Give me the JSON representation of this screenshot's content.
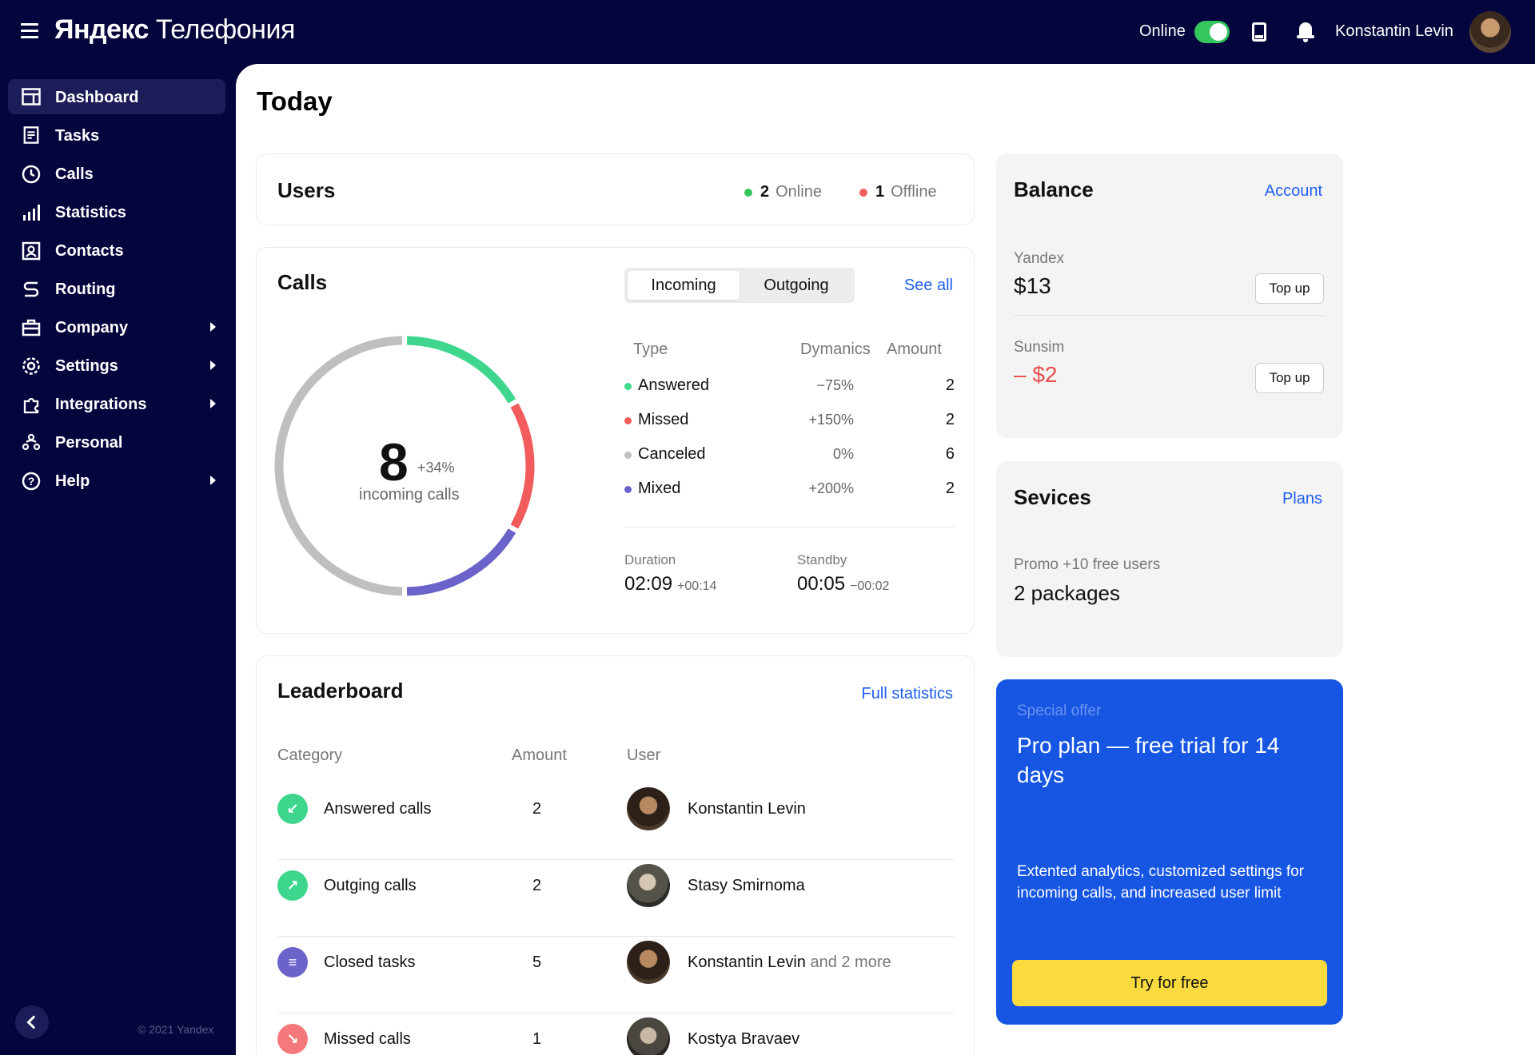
{
  "header": {
    "logo_bold": "Яндекс",
    "logo_rest": "Телефония",
    "online_label": "Online",
    "online_toggle": true,
    "user_name": "Konstantin Levin"
  },
  "sidebar": {
    "items": [
      {
        "label": "Dashboard",
        "icon": "dashboard-icon",
        "active": true,
        "has_submenu": false
      },
      {
        "label": "Tasks",
        "icon": "tasks-icon",
        "active": false,
        "has_submenu": false
      },
      {
        "label": "Calls",
        "icon": "clock-icon",
        "active": false,
        "has_submenu": false
      },
      {
        "label": "Statistics",
        "icon": "bar-chart-icon",
        "active": false,
        "has_submenu": false
      },
      {
        "label": "Contacts",
        "icon": "contacts-icon",
        "active": false,
        "has_submenu": false
      },
      {
        "label": "Routing",
        "icon": "routing-icon",
        "active": false,
        "has_submenu": false
      },
      {
        "label": "Company",
        "icon": "briefcase-icon",
        "active": false,
        "has_submenu": true
      },
      {
        "label": "Settings",
        "icon": "gear-icon",
        "active": false,
        "has_submenu": true
      },
      {
        "label": "Integrations",
        "icon": "puzzle-icon",
        "active": false,
        "has_submenu": true
      },
      {
        "label": "Personal",
        "icon": "people-icon",
        "active": false,
        "has_submenu": false
      },
      {
        "label": "Help",
        "icon": "help-icon",
        "active": false,
        "has_submenu": true
      }
    ],
    "copyright": "© 2021 Yandex"
  },
  "page": {
    "title": "Today"
  },
  "users": {
    "title": "Users",
    "online_count": "2",
    "online_label": "Online",
    "offline_count": "1",
    "offline_label": "Offline"
  },
  "calls": {
    "title": "Calls",
    "tabs": [
      "Incoming",
      "Outgoing"
    ],
    "active_tab": "Incoming",
    "see_all": "See all",
    "total": "8",
    "total_delta": "+34%",
    "total_label": "incoming calls",
    "columns": [
      "Type",
      "Dymanics",
      "Amount"
    ],
    "rows": [
      {
        "type": "Answered",
        "dynamics": "−75%",
        "amount": "2",
        "color": "#3dd68c"
      },
      {
        "type": "Missed",
        "dynamics": "+150%",
        "amount": "2",
        "color": "#f25c5c"
      },
      {
        "type": "Canceled",
        "dynamics": "0%",
        "amount": "6",
        "color": "#bfbfbf"
      },
      {
        "type": "Mixed",
        "dynamics": "+200%",
        "amount": "2",
        "color": "#6b63c9"
      }
    ],
    "duration_label": "Duration",
    "duration_value": "02:09",
    "duration_delta": "+00:14",
    "standby_label": "Standby",
    "standby_value": "00:05",
    "standby_delta": "−00:02"
  },
  "leaderboard": {
    "title": "Leaderboard",
    "link": "Full statistics",
    "columns": [
      "Category",
      "Amount",
      "User"
    ],
    "rows": [
      {
        "category": "Answered calls",
        "amount": "2",
        "user": "Konstantin Levin",
        "more": "",
        "icon": "incoming-arrow-icon",
        "color": "#3dd68c"
      },
      {
        "category": "Outging calls",
        "amount": "2",
        "user": "Stasy Smirnoma",
        "more": "",
        "icon": "outgoing-arrow-icon",
        "color": "#3dd68c"
      },
      {
        "category": "Closed tasks",
        "amount": "5",
        "user": "Konstantin Levin",
        "more": "and 2 more",
        "icon": "list-icon",
        "color": "#6b63c9"
      },
      {
        "category": "Missed calls",
        "amount": "1",
        "user": "Kostya Bravaev",
        "more": "",
        "icon": "missed-call-icon",
        "color": "#f5797b"
      }
    ]
  },
  "balance": {
    "title": "Balance",
    "link": "Account",
    "accounts": [
      {
        "name": "Yandex",
        "value": "$13",
        "button": "Top up",
        "negative": false
      },
      {
        "name": "Sunsim",
        "value": "– $2",
        "button": "Top up",
        "negative": true
      }
    ]
  },
  "services": {
    "title": "Sevices",
    "link": "Plans",
    "promo_label": "Promo +10 free users",
    "promo_value": "2 packages"
  },
  "offer": {
    "tag": "Special offer",
    "headline": "Pro plan — free trial for 14 days",
    "description": "Extented analytics, customized settings for incoming calls, and increased user limit",
    "button": "Try for free"
  },
  "colors": {
    "sidebar_bg": "#05053d",
    "accent_link": "#1e5ef0",
    "online_green": "#35c65e",
    "offer_blue": "#1656e3",
    "cta_yellow": "#fadb3f"
  }
}
